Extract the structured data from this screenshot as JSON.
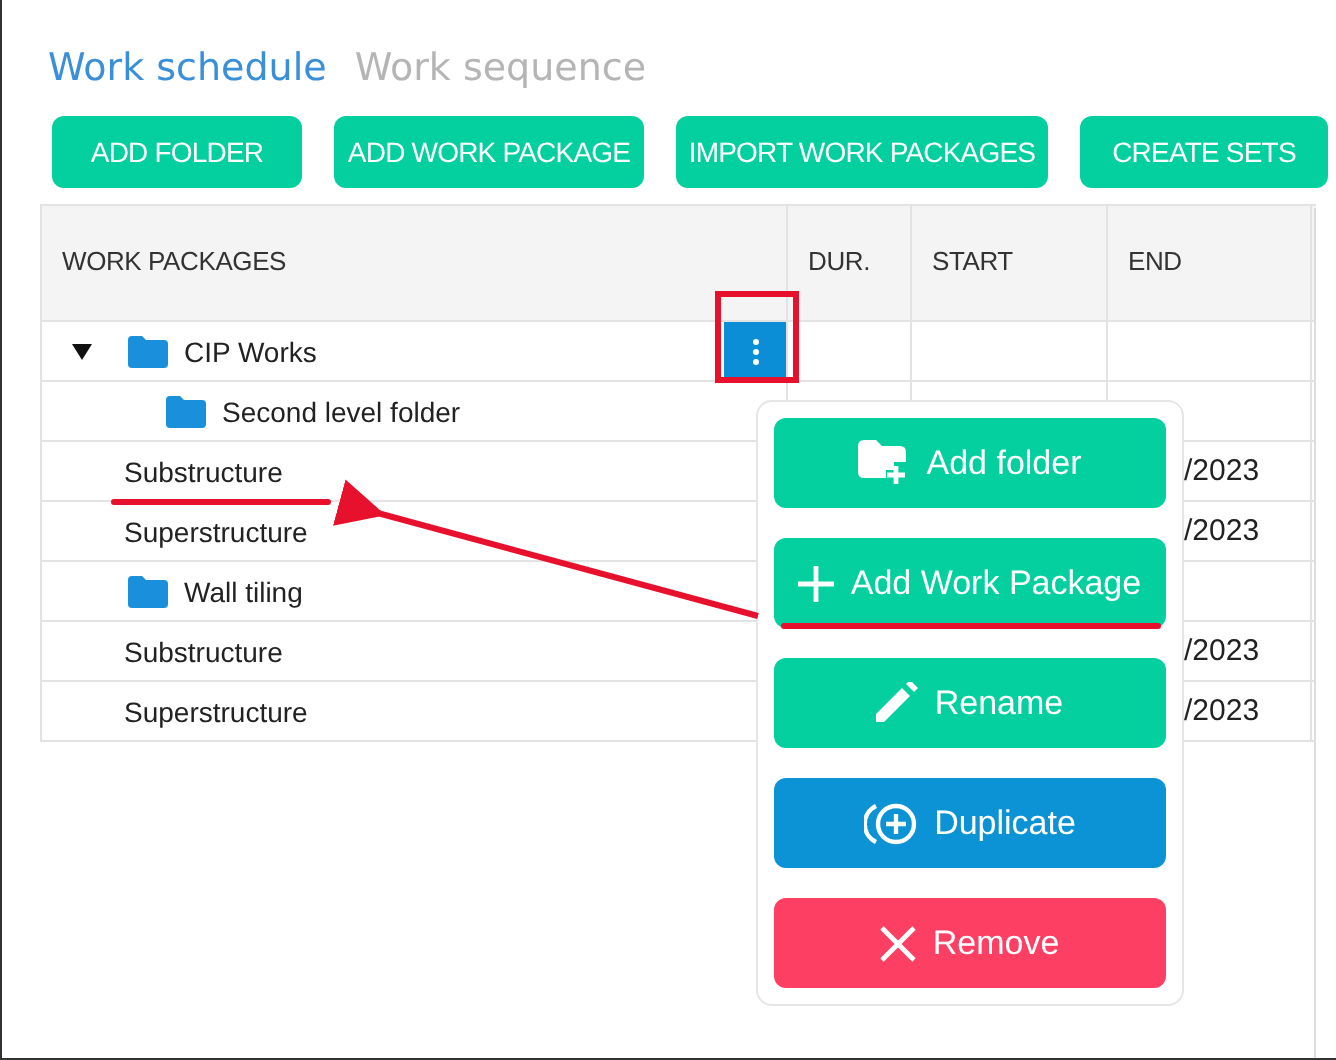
{
  "tabs": [
    {
      "label": "Work schedule",
      "selected": true
    },
    {
      "label": "Work sequence",
      "selected": false
    }
  ],
  "toolbar": [
    "ADD FOLDER",
    "ADD WORK PACKAGE",
    "IMPORT WORK PACKAGES",
    "CREATE SETS"
  ],
  "table": {
    "columns": [
      "WORK PACKAGES",
      "DUR.",
      "START",
      "END"
    ],
    "rows": [
      {
        "kind": "folder",
        "name": "CIP Works",
        "expanded": true,
        "hovered": true,
        "children": [
          {
            "kind": "folder",
            "name": "Second level folder",
            "expanded": false,
            "hovered": false
          },
          {
            "kind": "package",
            "name": "Substructure",
            "hovered": false,
            "end": "/2023"
          },
          {
            "kind": "package",
            "name": "Superstructure",
            "hovered": false,
            "end": "/2023"
          }
        ]
      },
      {
        "kind": "folder",
        "name": "Wall tiling",
        "expanded": false,
        "hovered": false,
        "children": [
          {
            "kind": "package",
            "name": "Substructure",
            "hovered": false,
            "end": "/2023"
          },
          {
            "kind": "package",
            "name": "Superstructure",
            "hovered": false,
            "end": "/2023"
          }
        ]
      }
    ]
  },
  "context_menu": [
    {
      "kind": "add-folder",
      "label": "Add folder",
      "color": "#04cf9f"
    },
    {
      "kind": "add",
      "label": "Add Work Package",
      "color": "#04cf9f"
    },
    {
      "kind": "rename",
      "label": "Rename",
      "color": "#04cf9f"
    },
    {
      "kind": "duplicate",
      "label": "Duplicate",
      "color": "#0b93d5"
    },
    {
      "kind": "remove",
      "label": "Remove",
      "color": "#fc3f63"
    }
  ]
}
